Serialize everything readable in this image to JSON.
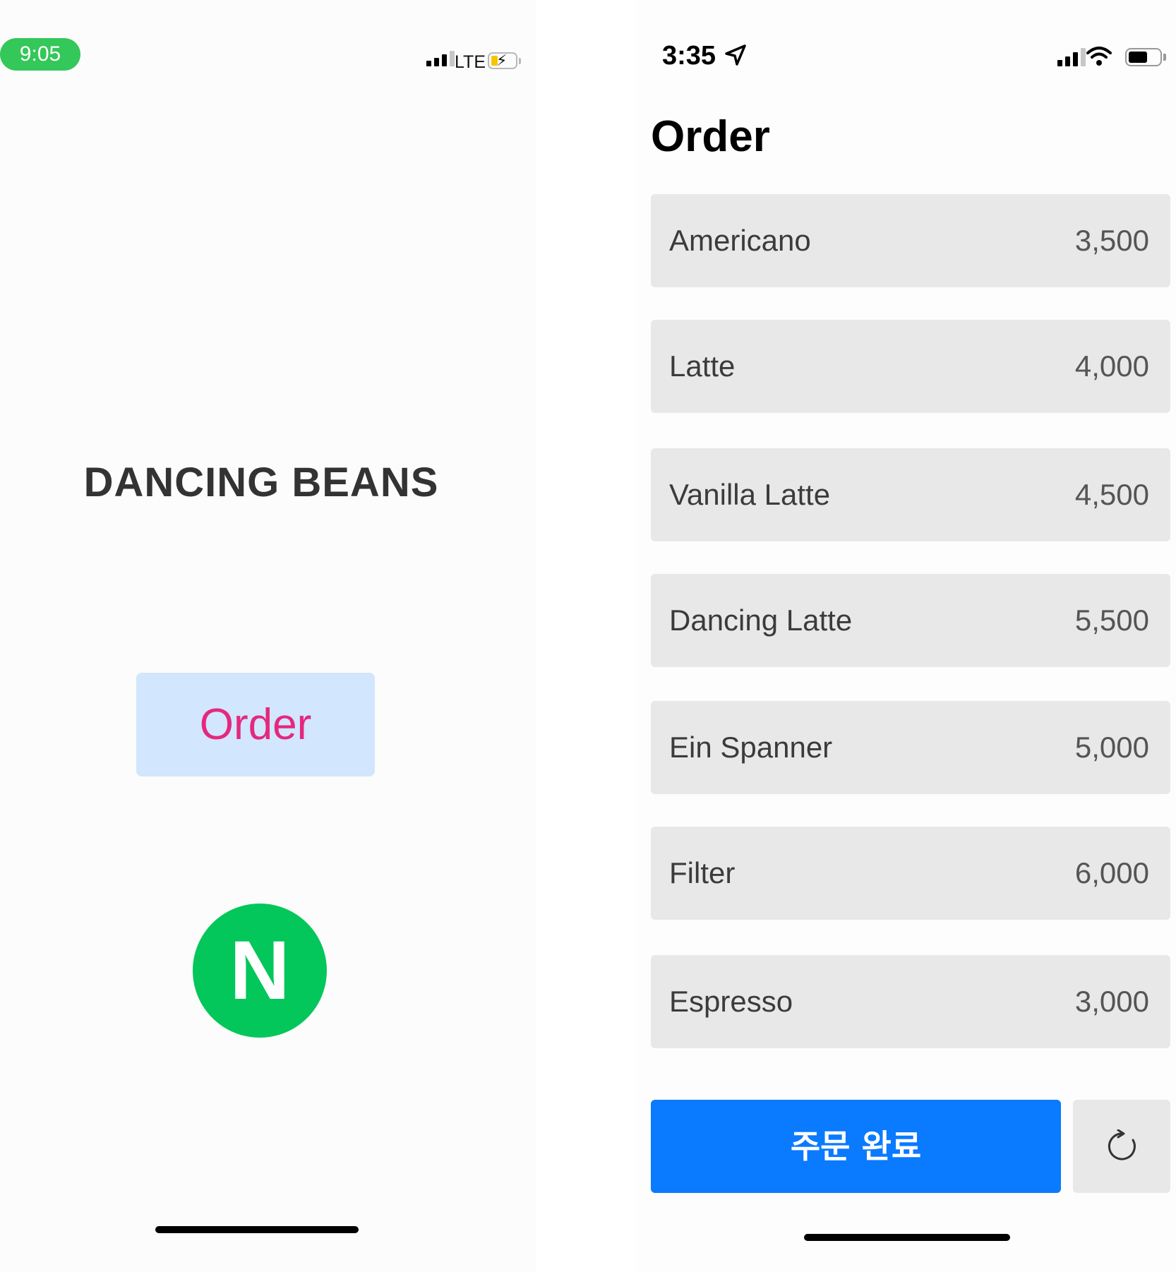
{
  "left_screen": {
    "status": {
      "time": "9:05",
      "network": "LTE"
    },
    "brand": "DANCING BEANS",
    "order_button_label": "Order",
    "naver_logo_letter": "N"
  },
  "right_screen": {
    "status": {
      "time": "3:35"
    },
    "title": "Order",
    "menu": [
      {
        "name": "Americano",
        "price": "3,500"
      },
      {
        "name": "Latte",
        "price": "4,000"
      },
      {
        "name": "Vanilla Latte",
        "price": "4,500"
      },
      {
        "name": "Dancing Latte",
        "price": "5,500"
      },
      {
        "name": "Ein Spanner",
        "price": "5,000"
      },
      {
        "name": "Filter",
        "price": "6,000"
      },
      {
        "name": "Espresso",
        "price": "3,000"
      }
    ],
    "complete_button_label": "주문 완료",
    "reset_icon": "refresh-icon"
  },
  "colors": {
    "accent_blue": "#0a7aff",
    "order_text_pink": "#e3297e",
    "order_button_bg": "#d2e6fd",
    "naver_green": "#03c75a",
    "status_pill_green": "#34c759",
    "menu_item_bg": "#e8e8e8"
  }
}
